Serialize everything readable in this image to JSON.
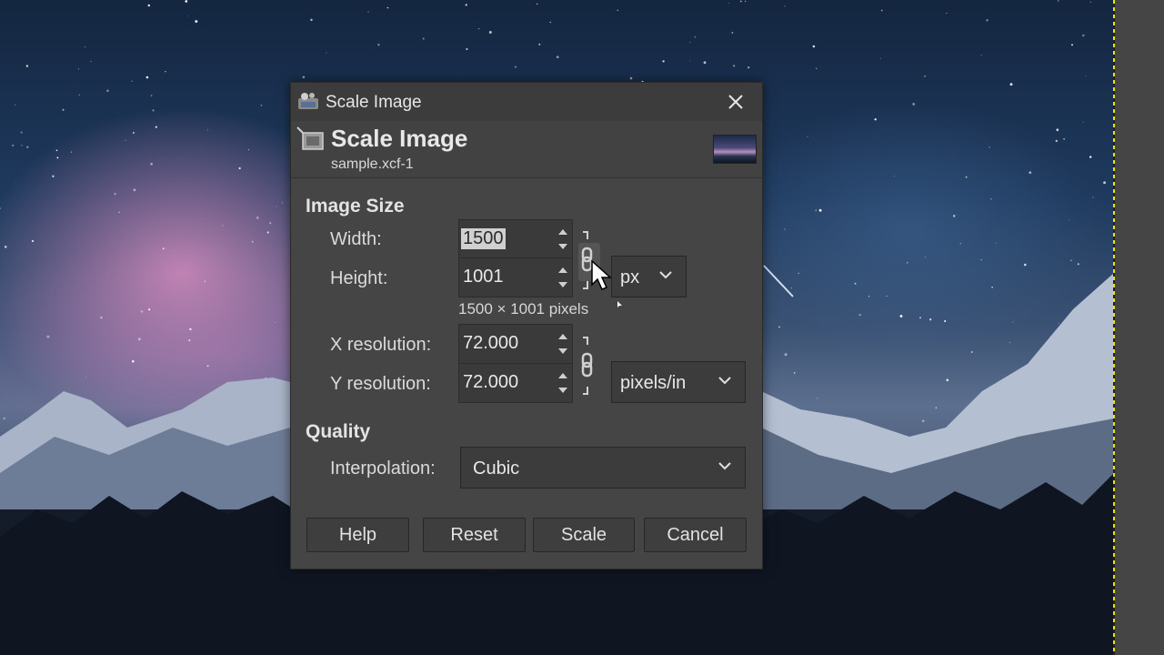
{
  "dialog": {
    "window_title": "Scale Image",
    "header_title": "Scale Image",
    "header_subtitle": "sample.xcf-1"
  },
  "image_size": {
    "section_title": "Image Size",
    "width_label": "Width:",
    "width_value": "1500",
    "height_label": "Height:",
    "height_value": "1001",
    "unit": "px",
    "pixel_info": "1500 × 1001 pixels",
    "xres_label": "X resolution:",
    "xres_value": "72.000",
    "yres_label": "Y resolution:",
    "yres_value": "72.000",
    "res_unit": "pixels/in"
  },
  "quality": {
    "section_title": "Quality",
    "interp_label": "Interpolation:",
    "interp_value": "Cubic"
  },
  "buttons": {
    "help": "Help",
    "reset": "Reset",
    "scale": "Scale",
    "cancel": "Cancel"
  },
  "colors": {
    "dialog_bg": "#454545",
    "canvas_edge": "#e8e800"
  },
  "icons": {
    "title_icon": "gimp-wilber-icon",
    "header_icon": "scale-image-icon",
    "close": "close-icon",
    "chain": "chain-link-icon",
    "chevron": "chevron-down-icon",
    "cursor": "mouse-pointer-icon"
  }
}
